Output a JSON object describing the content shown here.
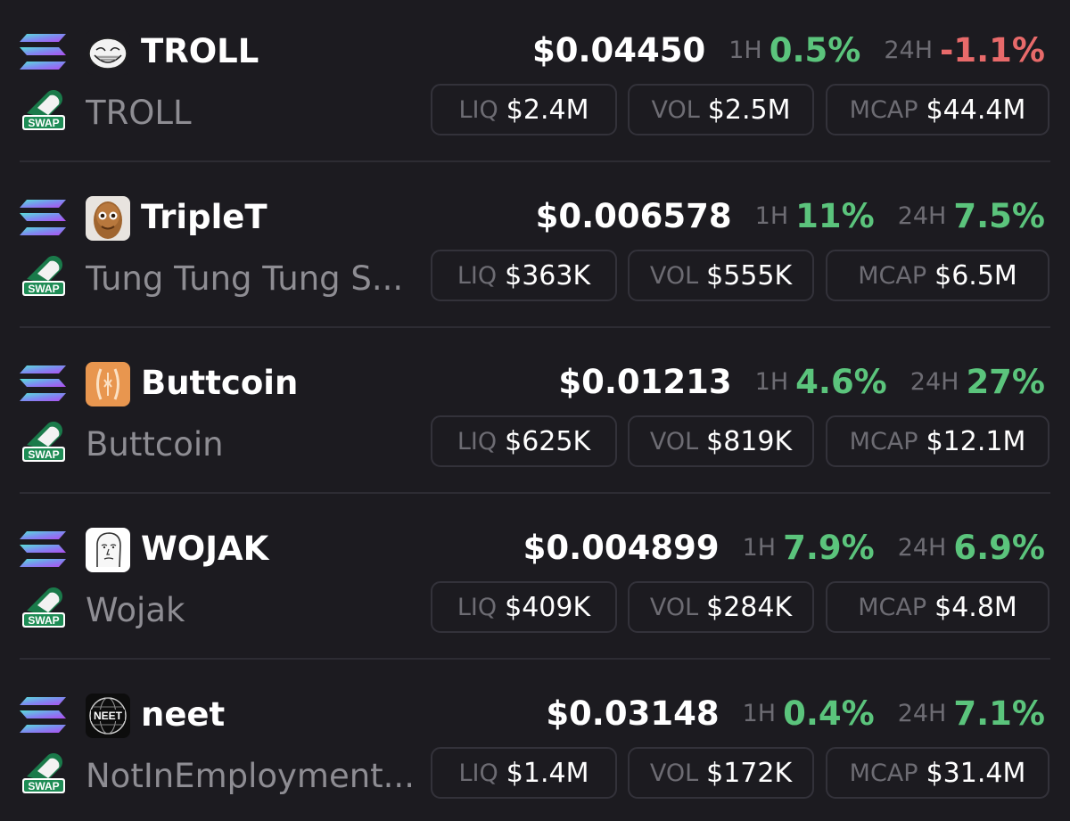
{
  "tokens": [
    {
      "symbol": "TROLL",
      "name": "TROLL",
      "avatar_icon": "trollface-icon",
      "price": "$0.04450",
      "h1_label": "1H",
      "h1_change": "0.5%",
      "h1_direction": "up",
      "h24_label": "24H",
      "h24_change": "-1.1%",
      "h24_direction": "down",
      "liq_label": "LIQ",
      "liq": "$2.4M",
      "vol_label": "VOL",
      "vol": "$2.5M",
      "mcap_label": "MCAP",
      "mcap": "$44.4M"
    },
    {
      "symbol": "TripleT",
      "name": "Tung Tung Tung S...",
      "avatar_icon": "triplet-face-icon",
      "price": "$0.006578",
      "h1_label": "1H",
      "h1_change": "11%",
      "h1_direction": "up",
      "h24_label": "24H",
      "h24_change": "7.5%",
      "h24_direction": "up",
      "liq_label": "LIQ",
      "liq": "$363K",
      "vol_label": "VOL",
      "vol": "$555K",
      "mcap_label": "MCAP",
      "mcap": "$6.5M"
    },
    {
      "symbol": "Buttcoin",
      "name": "Buttcoin",
      "avatar_icon": "buttcoin-icon",
      "price": "$0.01213",
      "h1_label": "1H",
      "h1_change": "4.6%",
      "h1_direction": "up",
      "h24_label": "24H",
      "h24_change": "27%",
      "h24_direction": "up",
      "liq_label": "LIQ",
      "liq": "$625K",
      "vol_label": "VOL",
      "vol": "$819K",
      "mcap_label": "MCAP",
      "mcap": "$12.1M"
    },
    {
      "symbol": "WOJAK",
      "name": "Wojak",
      "avatar_icon": "wojak-face-icon",
      "price": "$0.004899",
      "h1_label": "1H",
      "h1_change": "7.9%",
      "h1_direction": "up",
      "h24_label": "24H",
      "h24_change": "6.9%",
      "h24_direction": "up",
      "liq_label": "LIQ",
      "liq": "$409K",
      "vol_label": "VOL",
      "vol": "$284K",
      "mcap_label": "MCAP",
      "mcap": "$4.8M"
    },
    {
      "symbol": "neet",
      "name": "NotInEmployment...",
      "avatar_icon": "neet-globe-icon",
      "price": "$0.03148",
      "h1_label": "1H",
      "h1_change": "0.4%",
      "h1_direction": "up",
      "h24_label": "24H",
      "h24_change": "7.1%",
      "h24_direction": "up",
      "liq_label": "LIQ",
      "liq": "$1.4M",
      "vol_label": "VOL",
      "vol": "$172K",
      "mcap_label": "MCAP",
      "mcap": "$31.4M"
    }
  ],
  "chain_icon": "solana-icon",
  "dex_icon": "swap-icon",
  "dex_badge_text": "SWAP",
  "colors": {
    "background": "#1c1b20",
    "positive": "#5bc47c",
    "negative": "#e86a6a",
    "muted_text": "#8e8d93",
    "label_text": "#6d6c73",
    "pill_border": "#33323a"
  }
}
